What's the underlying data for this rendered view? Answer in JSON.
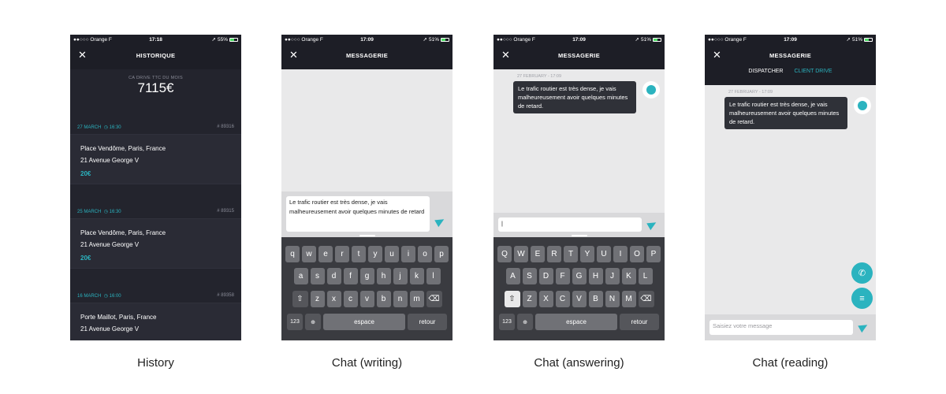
{
  "captions": [
    "History",
    "Chat (writing)",
    "Chat (answering)",
    "Chat (reading)"
  ],
  "status": {
    "carrier": "●●○○○ Orange F",
    "p1_time": "17:18",
    "p1_battery": "55%",
    "p2_time": "17:09",
    "p2_battery": "51%"
  },
  "history": {
    "title": "HISTORIQUE",
    "total_label": "CA DRIVE TTC DU MOIS",
    "total": "7115€",
    "entries": [
      {
        "date": "27 MARCH",
        "time": "16:30",
        "number": "# 89316",
        "from": "Place Vendôme, Paris, France",
        "to": "21 Avenue George V",
        "price": "20€"
      },
      {
        "date": "25 MARCH",
        "time": "16:30",
        "number": "# 89315",
        "from": "Place Vendôme, Paris, France",
        "to": "21 Avenue George V",
        "price": "20€"
      },
      {
        "date": "16 MARCH",
        "time": "16:00",
        "number": "# 89358",
        "from": "Porte Maillot, Paris, France",
        "to": "21 Avenue George V",
        "price": ""
      }
    ]
  },
  "chat": {
    "title": "MESSAGERIE",
    "message": "Le trafic routier est très dense, je vais malheureusement avoir quelques minutes de retard.",
    "draft": "Le trafic routier est très dense, je vais malheureusement avoir quelques minutes de retard",
    "timestamp": "27 FEBRUARY - 17:09",
    "tab_dispatcher": "DISPATCHER",
    "tab_client": "CLIENT DRIVE",
    "placeholder": "Saisiez votre message"
  },
  "keyboard": {
    "lower_row1": [
      "q",
      "w",
      "e",
      "r",
      "t",
      "y",
      "u",
      "i",
      "o",
      "p"
    ],
    "lower_row2": [
      "a",
      "s",
      "d",
      "f",
      "g",
      "h",
      "j",
      "k",
      "l"
    ],
    "lower_row3": [
      "z",
      "x",
      "c",
      "v",
      "b",
      "n",
      "m"
    ],
    "upper_row1": [
      "Q",
      "W",
      "E",
      "R",
      "T",
      "Y",
      "U",
      "I",
      "O",
      "P"
    ],
    "upper_row2": [
      "A",
      "S",
      "D",
      "F",
      "G",
      "H",
      "J",
      "K",
      "L"
    ],
    "upper_row3": [
      "Z",
      "X",
      "C",
      "V",
      "B",
      "N",
      "M"
    ],
    "num_key": "123",
    "space": "espace",
    "return": "retour"
  },
  "colors": {
    "accent": "#2bb3bf",
    "dark": "#1d1e26"
  },
  "icons": {
    "close": "close-icon",
    "send": "send-icon",
    "phone": "phone-icon",
    "notes": "notes-icon"
  }
}
